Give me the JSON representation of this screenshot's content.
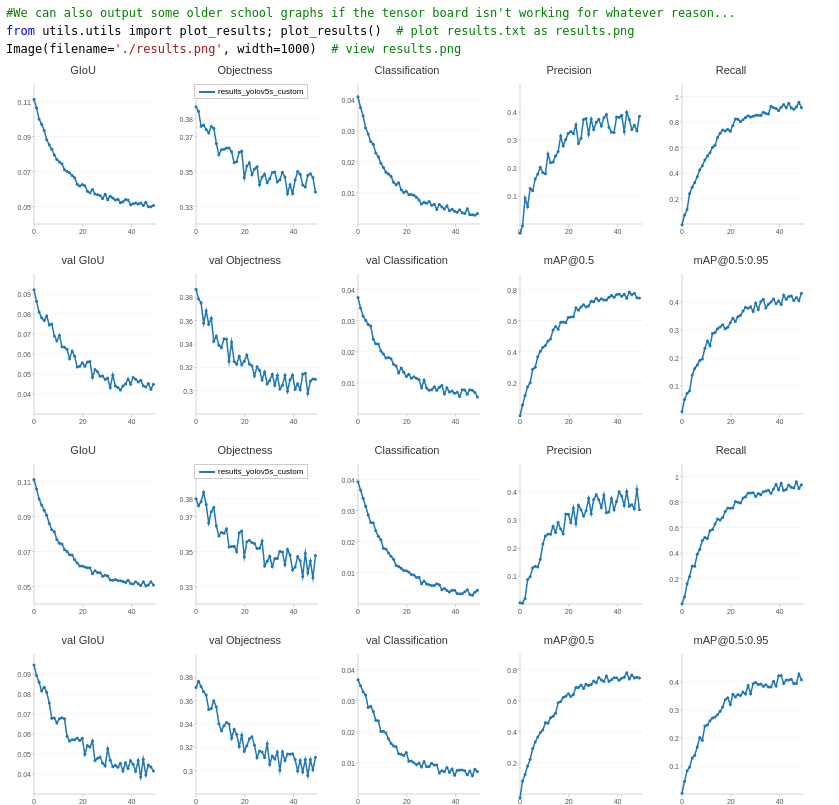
{
  "code": {
    "line1": "#We can also output some older school graphs if the tensor board isn't working for whatever reason...",
    "line2": "from utils.utils import plot_results; plot_results()  # plot results.txt as results.png",
    "line3": "Image(filename='./results.png', width=1000)  # view results.png"
  },
  "charts": {
    "row1_titles": [
      "GIoU",
      "Objectness",
      "Classification",
      "Precision",
      "Recall"
    ],
    "row2_titles": [
      "val GIoU",
      "val Objectness",
      "val Classification",
      "mAP@0.5",
      "mAP@0.5:0.95"
    ],
    "legend_label": "results_yolov5s_custom"
  }
}
